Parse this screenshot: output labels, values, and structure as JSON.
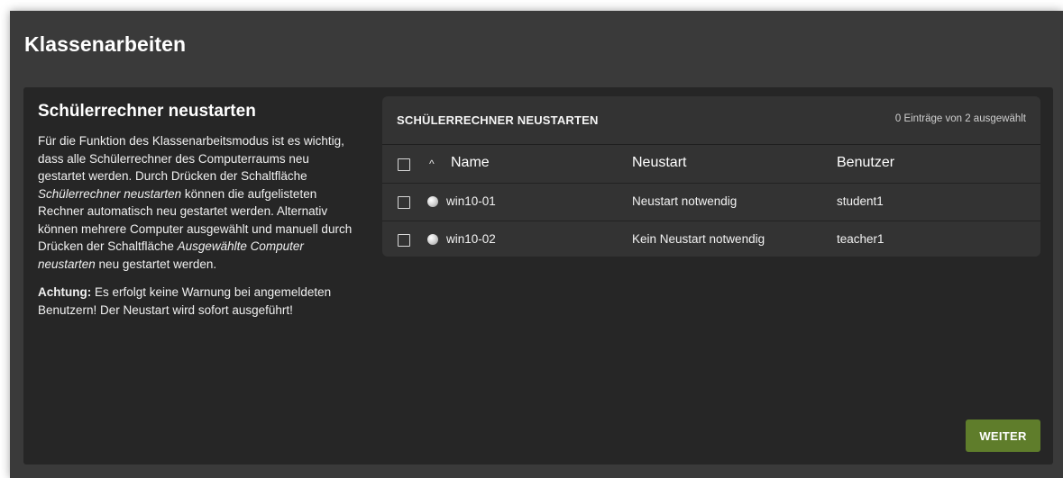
{
  "window": {
    "title": "Klassenarbeiten"
  },
  "info": {
    "heading": "Schülerrechner neustarten",
    "p1_a": "Für die Funktion des Klassenarbeitsmodus ist es wichtig, dass alle Schülerrechner des Computerraums neu gestartet werden. Durch Drücken der Schaltfläche ",
    "p1_em1": "Schülerrechner neustarten",
    "p1_b": " können die aufgelisteten Rechner automatisch neu gestartet werden. Alternativ können mehrere Computer ausgewählt und manuell durch Drücken der Schaltfläche ",
    "p1_em2": "Ausgewählte Computer neustarten",
    "p1_c": " neu gestartet werden.",
    "p2_strong": "Achtung:",
    "p2_text": " Es erfolgt keine Warnung bei angemeldeten Benutzern! Der Neustart wird sofort ausgeführt!"
  },
  "grid": {
    "title": "SCHÜLERRECHNER NEUSTARTEN",
    "selection_info": "0 Einträge von 2 ausgewählt",
    "sort_icon": "chevron-up-icon",
    "sort_glyph": "^",
    "columns": {
      "name": "Name",
      "restart": "Neustart",
      "user": "Benutzer"
    },
    "rows": [
      {
        "name": "win10-01",
        "restart": "Neustart notwendig",
        "user": "student1",
        "status_icon": "status-dot-icon"
      },
      {
        "name": "win10-02",
        "restart": "Kein Neustart notwendig",
        "user": "teacher1",
        "status_icon": "status-dot-icon"
      }
    ]
  },
  "actions": {
    "next_label": "WEITER",
    "next_color": "#5f7d2b"
  }
}
